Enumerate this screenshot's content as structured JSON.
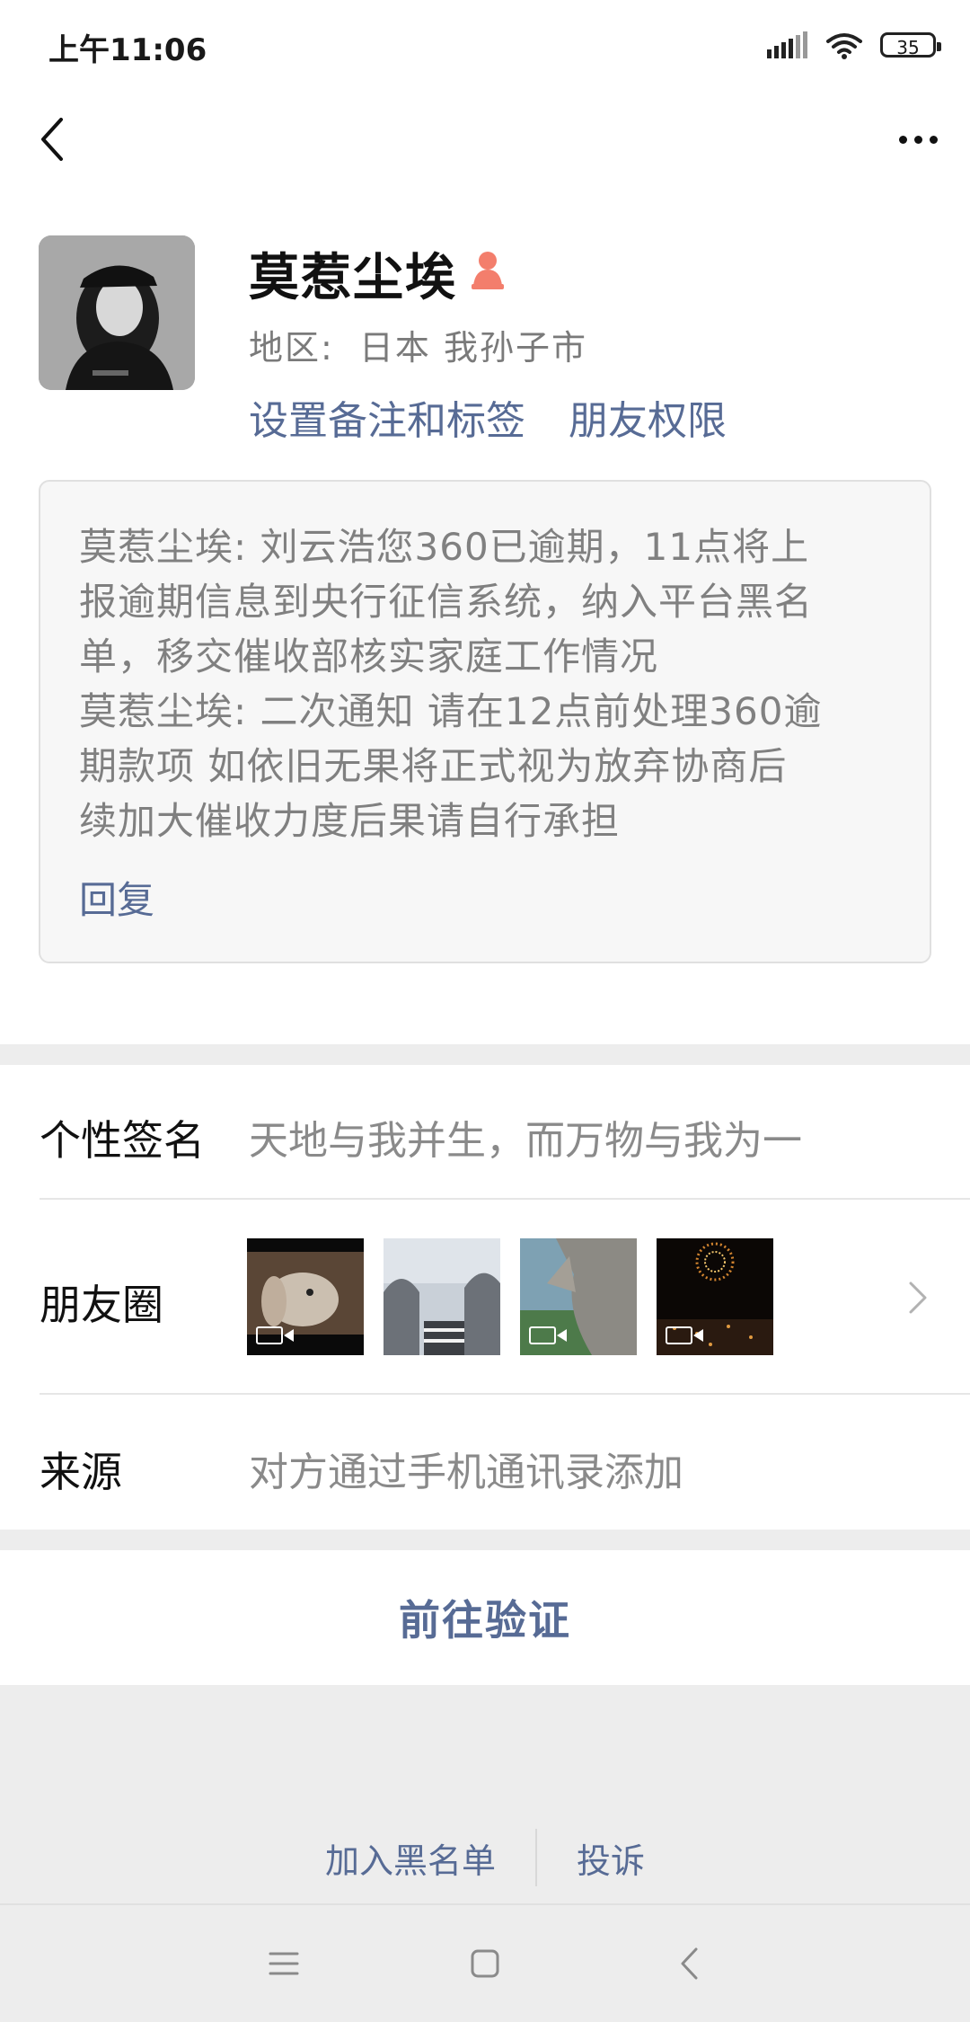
{
  "status_bar": {
    "time": "上午11:06",
    "battery": "35"
  },
  "profile": {
    "name": "莫惹尘埃",
    "region_label": "地区:",
    "region_value": "日本  我孙子市",
    "links": [
      "设置备注和标签",
      "朋友权限"
    ]
  },
  "messages": {
    "lines": [
      "莫惹尘埃: 刘云浩您360已逾期，11点将上",
      "报逾期信息到央行征信系统，纳入平台黑名",
      "单，移交催收部核实家庭工作情况",
      "莫惹尘埃: 二次通知 请在12点前处理360逾",
      "期款项 如依旧无果将正式视为放弃协商后",
      "续加大催收力度后果请自行承担"
    ],
    "reply_label": "回复"
  },
  "details": {
    "signature_label": "个性签名",
    "signature_value": "天地与我并生，而万物与我为一",
    "moments_label": "朋友圈",
    "source_label": "来源",
    "source_value": "对方通过手机通讯录添加"
  },
  "actions": {
    "verify_label": "前往验证",
    "block_label": "加入黑名单",
    "report_label": "投诉"
  },
  "icons": [
    "back-icon",
    "more-icon",
    "gender-female-icon",
    "video-icon",
    "chevron-right-icon",
    "menu-icon",
    "home-icon",
    "nav-back-icon"
  ],
  "colors": {
    "link": "#576b95",
    "gender": "#f37e6c",
    "background": "#ededed"
  }
}
